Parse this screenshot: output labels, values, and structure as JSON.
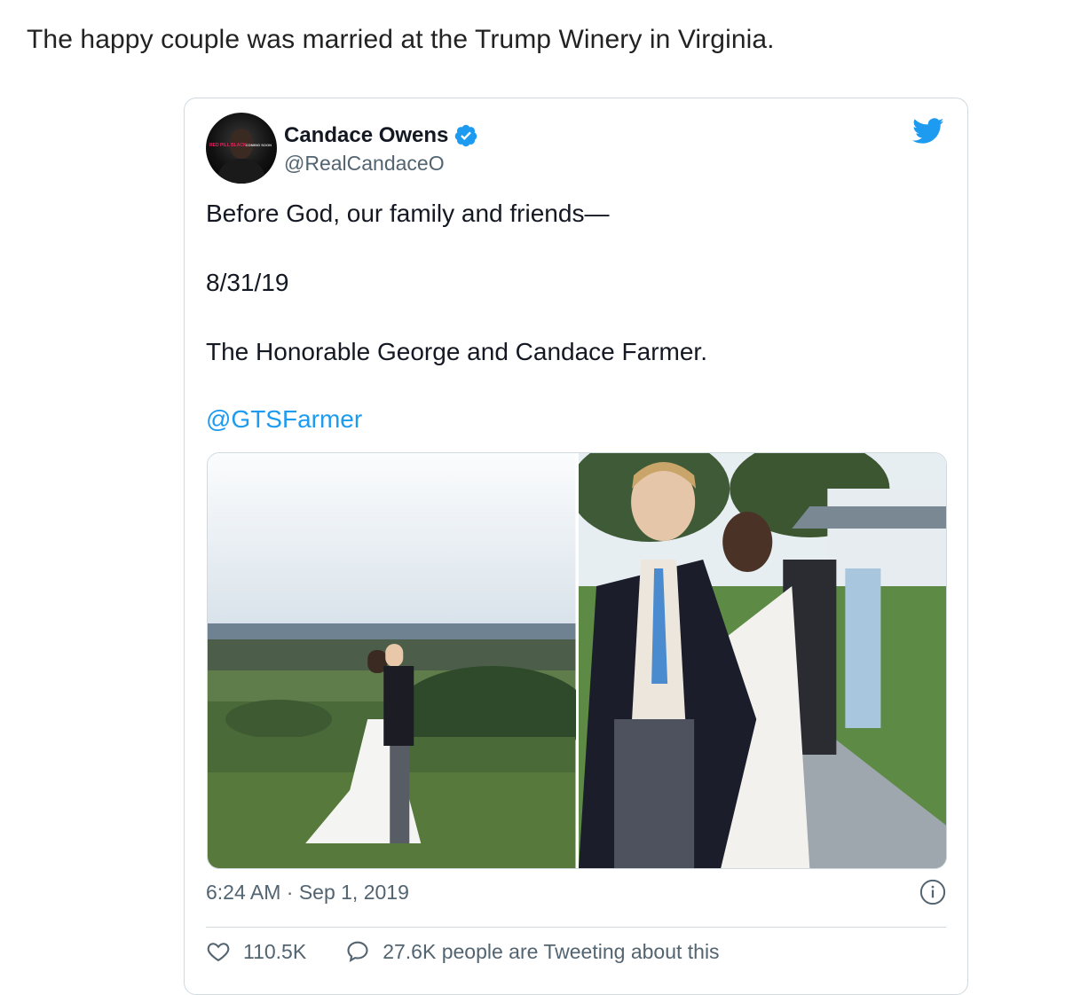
{
  "article": {
    "text": "The happy couple was married at the Trump Winery in Virginia."
  },
  "tweet": {
    "display_name": "Candace Owens",
    "handle": "@RealCandaceO",
    "lines": [
      "Before God, our family and friends—",
      "8/31/19",
      "The Honorable George and Candace Farmer."
    ],
    "mention": "@GTSFarmer",
    "timestamp": "6:24 AM · Sep 1, 2019",
    "likes": "110.5K",
    "tweeting": "27.6K people are Tweeting about this",
    "avatar_text_left": "RED PILL BLACK",
    "avatar_text_right": "COMING SOON"
  },
  "icons": {
    "verified": "verified-badge-icon",
    "bird": "twitter-bird-icon",
    "info": "info-icon",
    "like": "heart-icon",
    "reply": "speech-bubble-icon"
  },
  "colors": {
    "link": "#1d9bf0",
    "muted": "#536471",
    "border": "#cfd9de"
  }
}
